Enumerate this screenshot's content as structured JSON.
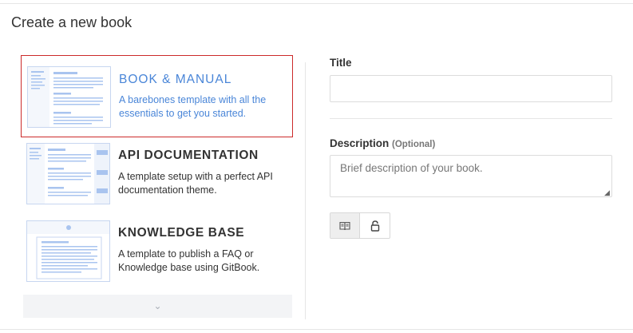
{
  "page": {
    "title": "Create a new book"
  },
  "templates": [
    {
      "name": "BOOK & MANUAL",
      "description": "A barebones template with all the essentials to get you started.",
      "selected": true,
      "thumb_icon": "book-manual-thumbnail-icon"
    },
    {
      "name": "API DOCUMENTATION",
      "description": "A template setup with a perfect API documentation theme.",
      "selected": false,
      "thumb_icon": "api-documentation-thumbnail-icon"
    },
    {
      "name": "KNOWLEDGE BASE",
      "description": "A template to publish a FAQ or Knowledge base using GitBook.",
      "selected": false,
      "thumb_icon": "knowledge-base-thumbnail-icon"
    }
  ],
  "more": {
    "icon": "chevron-down-icon",
    "glyph": "⌄"
  },
  "form": {
    "title_label": "Title",
    "title_value": "",
    "description_label": "Description",
    "description_optional": "(Optional)",
    "description_placeholder": "Brief description of your book.",
    "visibility": {
      "public_icon": "book-icon",
      "private_icon": "lock-icon",
      "selected": "public"
    }
  },
  "colors": {
    "accent": "#4a86d8",
    "selected_border": "#cc2a2a",
    "thumb_line": "#a9c4ef"
  }
}
